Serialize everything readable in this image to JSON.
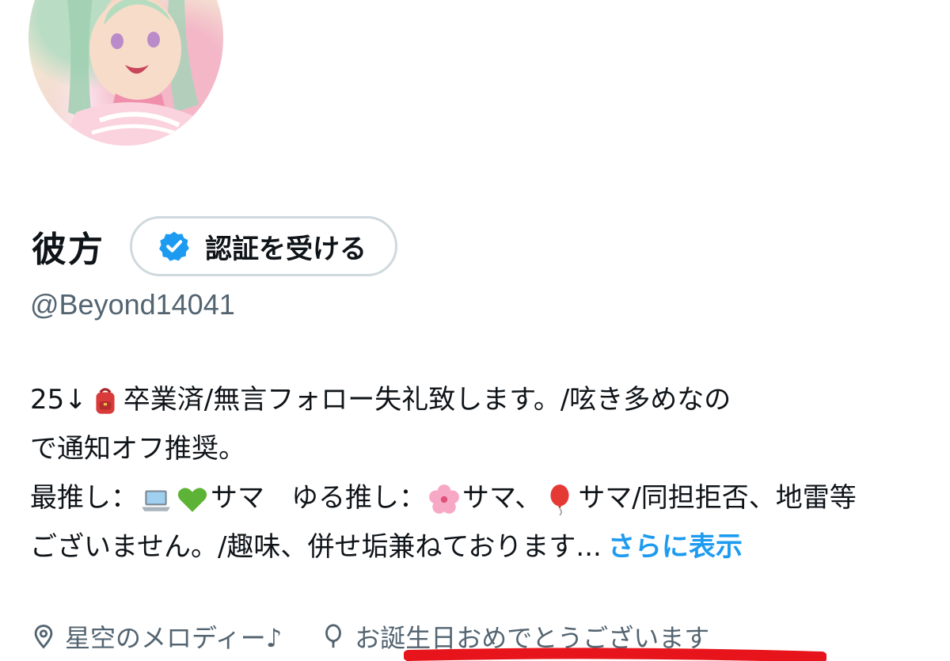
{
  "profile": {
    "display_name": "彼方",
    "verify_button_label": "認証を受ける",
    "handle": "@Beyond14041"
  },
  "bio": {
    "line1_a": "25↓",
    "line1_b": "卒業済/無言フォロー失礼致します。/呟き多めなの",
    "line2": "で通知オフ推奨。",
    "line3_a": "最推し：",
    "line3_b": "サマ　ゆる推し：",
    "line3_c": "サマ、",
    "line3_d": "サマ/同担拒否、地雷等",
    "line4": "ございません。/趣味、併せ垢兼ねております...",
    "more_link": "さらに表示"
  },
  "meta": {
    "location": "星空のメロディー♪",
    "birthday": "お誕生日おめでとうございます"
  },
  "icons": {
    "verified": "verified-badge-icon",
    "location": "location-pin-icon",
    "birthday": "balloon-icon",
    "emoji_1": "backpack-emoji",
    "emoji_2": "laptop-emoji",
    "emoji_3": "green-heart-emoji",
    "emoji_4": "cherry-blossom-emoji",
    "emoji_5": "red-balloon-emoji"
  },
  "colors": {
    "link": "#1d9bf0",
    "secondary_text": "#536471",
    "border": "#cfd9de",
    "highlight_mark": "#e8141b"
  }
}
